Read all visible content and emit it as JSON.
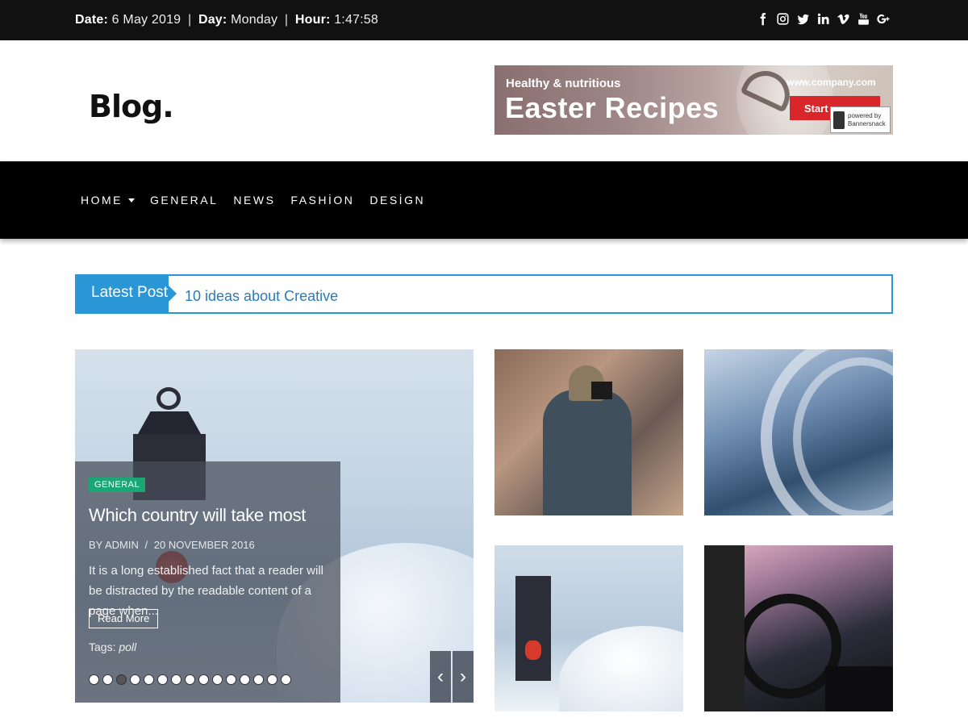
{
  "topbar": {
    "date_label": "Date:",
    "date_value": "6 May 2019",
    "day_label": "Day:",
    "day_value": "Monday",
    "hour_label": "Hour:",
    "hour_value": "1:47:58",
    "separator": "|",
    "social_icons": [
      "facebook-icon",
      "instagram-icon",
      "twitter-icon",
      "linkedin-icon",
      "vimeo-icon",
      "youtube-icon",
      "google-plus-icon"
    ]
  },
  "header": {
    "brand": "Blog.",
    "banner": {
      "small": "Healthy & nutritious",
      "big": "Easter Recipes",
      "url": "www.company.com",
      "cta": "Start c",
      "powered_by": "powered by",
      "powered_name": "Bannersnack"
    }
  },
  "nav": {
    "items": [
      {
        "label": "HOME",
        "has_dropdown": true
      },
      {
        "label": "GENERAL",
        "has_dropdown": false
      },
      {
        "label": "NEWS",
        "has_dropdown": false
      },
      {
        "label": "FASHİON",
        "has_dropdown": false
      },
      {
        "label": "DESİGN",
        "has_dropdown": false
      }
    ]
  },
  "ticker": {
    "label": "Latest Post",
    "link": "10 ideas about Creative"
  },
  "slider": {
    "category": "GENERAL",
    "title": "Which country will take most",
    "author": "BY ADMIN",
    "meta_sep": "/",
    "date": "20 NOVEMBER 2016",
    "excerpt": "It is a long established fact that a reader will be distracted by the readable content of a page when...",
    "read_more": "Read More",
    "tags_label": "Tags:",
    "tags_value": "poll",
    "dot_count": 15,
    "active_dot": 3,
    "prev": "‹",
    "next": "›"
  },
  "colors": {
    "accent": "#2a96d6",
    "tag": "#19a774",
    "topbar": "#111111",
    "nav": "#000000"
  }
}
